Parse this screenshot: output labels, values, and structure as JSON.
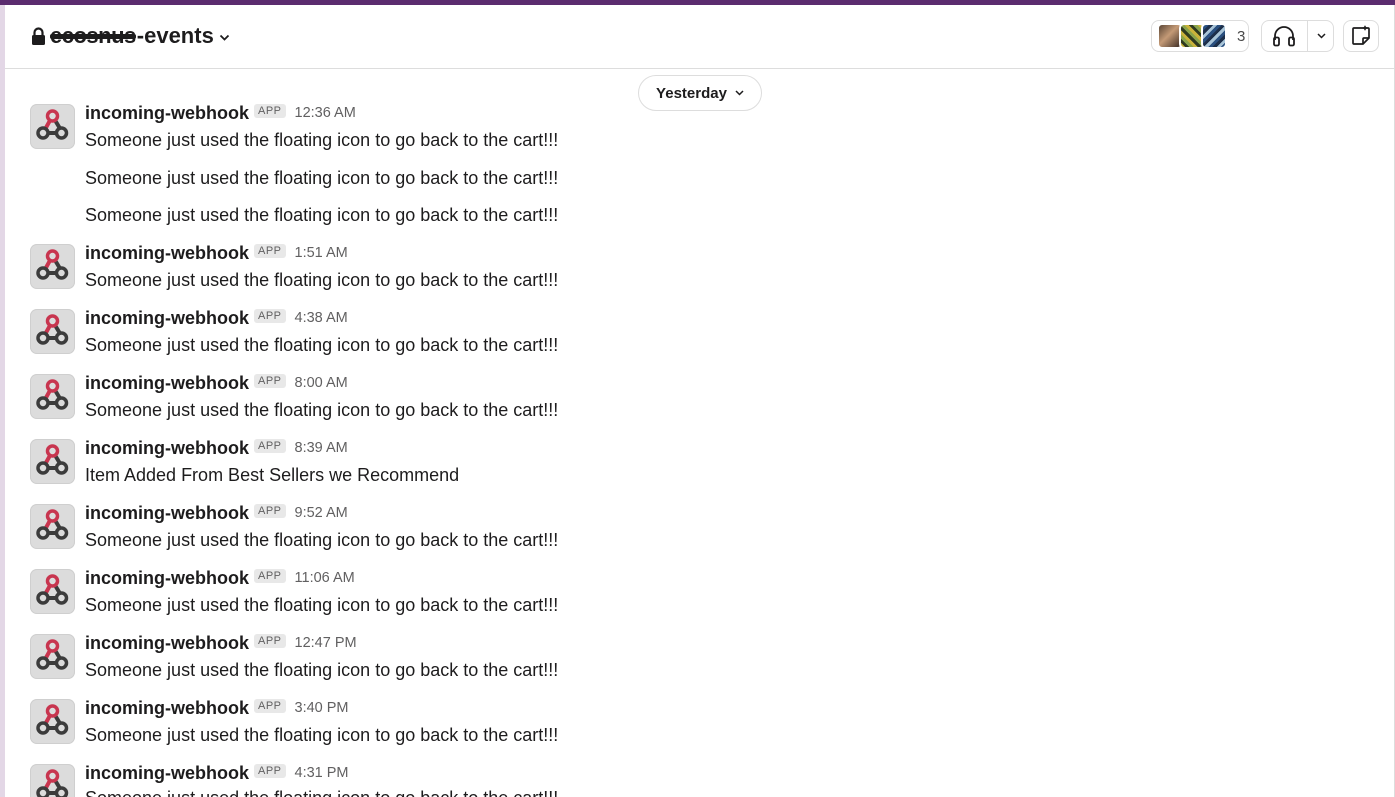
{
  "header": {
    "channel_redacted": "ecosnus",
    "channel_suffix": "-events",
    "member_count": "3"
  },
  "date_divider": {
    "label": "Yesterday"
  },
  "messages": [
    {
      "sender": "incoming-webhook",
      "badge": "APP",
      "time": "12:36 AM",
      "texts": [
        "Someone just used the floating icon to go back to the cart!!!",
        "Someone just used the floating icon to go back to the cart!!!",
        "Someone just used the floating icon to go back to the cart!!!"
      ]
    },
    {
      "sender": "incoming-webhook",
      "badge": "APP",
      "time": "1:51 AM",
      "texts": [
        "Someone just used the floating icon to go back to the cart!!!"
      ]
    },
    {
      "sender": "incoming-webhook",
      "badge": "APP",
      "time": "4:38 AM",
      "texts": [
        "Someone just used the floating icon to go back to the cart!!!"
      ]
    },
    {
      "sender": "incoming-webhook",
      "badge": "APP",
      "time": "8:00 AM",
      "texts": [
        "Someone just used the floating icon to go back to the cart!!!"
      ]
    },
    {
      "sender": "incoming-webhook",
      "badge": "APP",
      "time": "8:39 AM",
      "texts": [
        "Item Added From Best Sellers we Recommend"
      ]
    },
    {
      "sender": "incoming-webhook",
      "badge": "APP",
      "time": "9:52 AM",
      "texts": [
        "Someone just used the floating icon to go back to the cart!!!"
      ]
    },
    {
      "sender": "incoming-webhook",
      "badge": "APP",
      "time": "11:06 AM",
      "texts": [
        "Someone just used the floating icon to go back to the cart!!!"
      ]
    },
    {
      "sender": "incoming-webhook",
      "badge": "APP",
      "time": "12:47 PM",
      "texts": [
        "Someone just used the floating icon to go back to the cart!!!"
      ]
    },
    {
      "sender": "incoming-webhook",
      "badge": "APP",
      "time": "3:40 PM",
      "texts": [
        "Someone just used the floating icon to go back to the cart!!!"
      ]
    },
    {
      "sender": "incoming-webhook",
      "badge": "APP",
      "time": "4:31 PM",
      "texts": [
        "Someone just used the floating icon to go back to the cart!!!"
      ]
    }
  ],
  "colors": {
    "workspace_bar": "#5b2c6f",
    "webhook_pink": "#c8354f",
    "webhook_dark": "#3c3c3c"
  },
  "icons": {
    "channel": "lock-icon",
    "huddle": "headphones-icon",
    "canvas": "canvas-icon",
    "avatar": "webhook-icon"
  }
}
